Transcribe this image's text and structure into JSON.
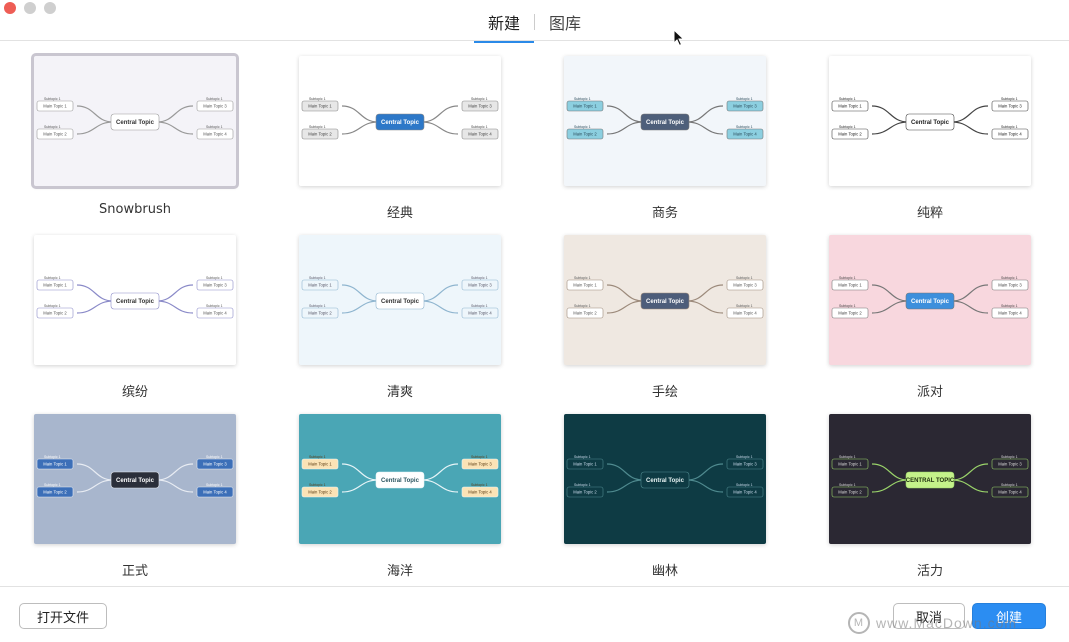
{
  "tabs": [
    {
      "label": "新建",
      "active": true
    },
    {
      "label": "图库",
      "active": false
    }
  ],
  "templates": [
    {
      "name": "Snowbrush",
      "bg": "#f4f3f8",
      "line": "#999",
      "central_bg": "#ffffff",
      "central_fg": "#333",
      "topic_bg": "#ffffff",
      "topic_fg": "#555",
      "central": "Central Topic",
      "topic": "Main Topic",
      "sub": "Subtopic",
      "selected": true
    },
    {
      "name": "经典",
      "bg": "#ffffff",
      "line": "#888",
      "central_bg": "#2d78c8",
      "central_fg": "#ffffff",
      "topic_bg": "#e7e7e7",
      "topic_fg": "#444",
      "central": "Central Topic",
      "topic": "Main Topic",
      "sub": "Subtopic",
      "selected": false
    },
    {
      "name": "商务",
      "bg": "#f2f6fa",
      "line": "#777",
      "central_bg": "#4e5f7a",
      "central_fg": "#ffffff",
      "topic_bg": "#8ccfe0",
      "topic_fg": "#2b4b5a",
      "central": "Central Topic",
      "topic": "Main Topic",
      "sub": "Subtopic",
      "selected": false
    },
    {
      "name": "纯粹",
      "bg": "#ffffff",
      "line": "#444",
      "central_bg": "#ffffff",
      "central_fg": "#222",
      "topic_bg": "#ffffff",
      "topic_fg": "#222",
      "central": "Central Topic",
      "topic": "Main Topic",
      "sub": "Subtopic",
      "selected": false
    },
    {
      "name": "缤纷",
      "bg": "#ffffff",
      "line": "#8a8ac8",
      "central_bg": "#ffffff",
      "central_fg": "#333",
      "topic_bg": "#ffffff",
      "topic_fg": "#555",
      "central": "Central Topic",
      "topic": "Main Topic",
      "sub": "Subtopic",
      "selected": false
    },
    {
      "name": "清爽",
      "bg": "#eef6fb",
      "line": "#8fb5cf",
      "central_bg": "#ffffff",
      "central_fg": "#333",
      "topic_bg": "#eef6fb",
      "topic_fg": "#556",
      "central": "Central Topic",
      "topic": "Main Topic",
      "sub": "Subtopic",
      "selected": false
    },
    {
      "name": "手绘",
      "bg": "#efe8e1",
      "line": "#9c8a7b",
      "central_bg": "#4d5d7a",
      "central_fg": "#ffffff",
      "topic_bg": "#ffffff",
      "topic_fg": "#555",
      "central": "Central Topic",
      "topic": "Main Topic",
      "sub": "Subtopic",
      "selected": false
    },
    {
      "name": "派对",
      "bg": "#f8d7de",
      "line": "#777",
      "central_bg": "#3d8fdc",
      "central_fg": "#ffffff",
      "topic_bg": "#ffffff",
      "topic_fg": "#444",
      "central": "Central Topic",
      "topic": "Main Topic",
      "sub": "Subtopic",
      "selected": false
    },
    {
      "name": "正式",
      "bg": "#a8b6cd",
      "line": "#e8ecf3",
      "central_bg": "#2b2f3a",
      "central_fg": "#ffffff",
      "topic_bg": "#3c6fb8",
      "topic_fg": "#ffffff",
      "central": "Central Topic",
      "topic": "Main Topic",
      "sub": "Subtopic",
      "selected": false
    },
    {
      "name": "海洋",
      "bg": "#4aa6b5",
      "line": "#e6f4f7",
      "central_bg": "#ffffff",
      "central_fg": "#2b5560",
      "topic_bg": "#fbe3b6",
      "topic_fg": "#5a3a12",
      "central": "Central Topic",
      "topic": "Main Topic",
      "sub": "Subtopic",
      "selected": false
    },
    {
      "name": "幽林",
      "bg": "#0e3b44",
      "line": "#4f8a8f",
      "central_bg": "#0e3b44",
      "central_fg": "#e6f2f2",
      "topic_bg": "#0e3b44",
      "topic_fg": "#cde",
      "central": "Central Topic",
      "topic": "Main Topic",
      "sub": "Subtopic",
      "selected": false
    },
    {
      "name": "活力",
      "bg": "#2b2833",
      "line": "#9ad36a",
      "central_bg": "#c4f28a",
      "central_fg": "#203010",
      "topic_bg": "#2b2833",
      "topic_fg": "#ddd",
      "central": "CENTRAL TOPIC",
      "topic": "Main Topic",
      "sub": "Subtopic",
      "selected": false
    }
  ],
  "footer": {
    "open_file": "打开文件",
    "cancel": "取消",
    "create": "创建"
  },
  "watermark": "www.MacDown.com"
}
